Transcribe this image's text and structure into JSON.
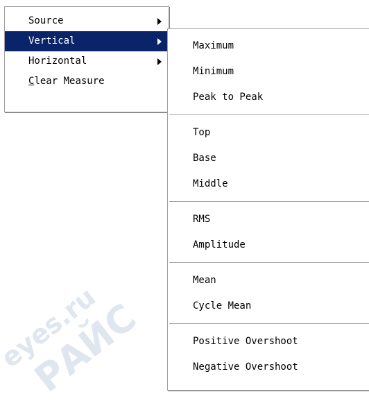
{
  "watermark": {
    "texts": [
      "supereyes.ru",
      "СУПЕРАЙС",
      "eyes.ru",
      "РАЙС",
      "ЕРАЙС"
    ]
  },
  "context_menu": {
    "items": [
      {
        "label": "Source",
        "has_submenu": true
      },
      {
        "label": "Vertical",
        "has_submenu": true,
        "selected": true
      },
      {
        "label": "Horizontal",
        "has_submenu": true
      },
      {
        "label_mnemonic": "C",
        "label_rest": "lear Measure",
        "has_submenu": false
      }
    ]
  },
  "vertical_submenu": {
    "groups": [
      [
        "Maximum",
        "Minimum",
        "Peak to Peak"
      ],
      [
        "Top",
        "Base",
        "Middle"
      ],
      [
        "RMS",
        "Amplitude"
      ],
      [
        "Mean",
        "Cycle Mean"
      ],
      [
        "Positive Overshoot",
        "Negative Overshoot"
      ]
    ]
  },
  "colors": {
    "selection_bg": "#0a246a",
    "selection_fg": "#ffffff",
    "border": "#a0a0a0"
  }
}
